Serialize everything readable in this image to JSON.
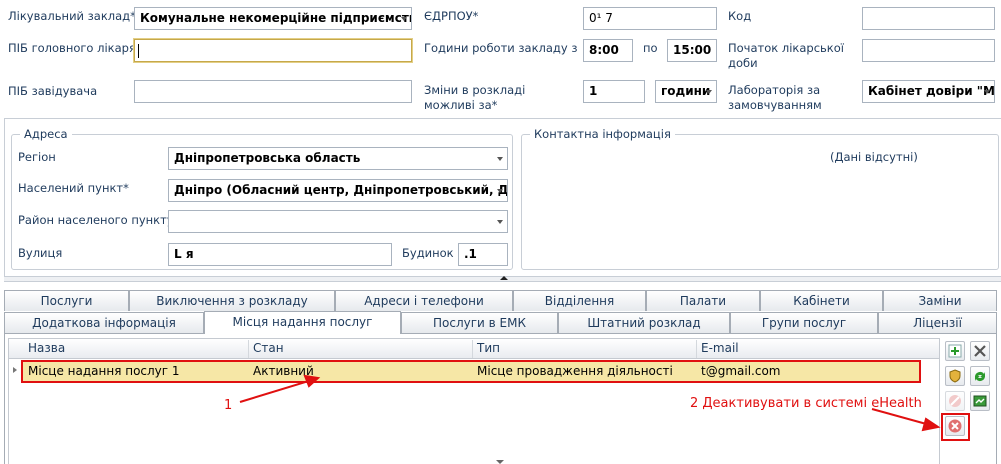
{
  "form": {
    "facility_label": "Лікувальний заклад*",
    "facility_value": "Комунальне некомерційне підприємство \"I",
    "edrpou_label": "ЄДРПОУ*",
    "edrpou_value": "0¹    7",
    "code_label": "Код",
    "code_value": "",
    "chief_label": "ПІБ головного лікаря",
    "chief_value": "",
    "hours_label": "Години роботи закладу з",
    "hours_from": "8:00",
    "hours_to_label": "по",
    "hours_to": "15:00",
    "start_label": "Початок лікарської доби",
    "start_value": "",
    "head_label": "ПІБ завідувача",
    "head_value": "",
    "changes_label": "Зміни в розкладі можливі за*",
    "changes_value": "1",
    "changes_unit": "години",
    "lab_label": "Лабораторія за замовчуванням",
    "lab_value": "Кабінет довіри \"Мі"
  },
  "address": {
    "title": "Адреса",
    "region_label": "Регіон",
    "region_value": "Дніпропетровська область",
    "city_label": "Населений пункт*",
    "city_value": "Дніпро (Обласний центр, Дніпропетровський, Дніпро",
    "district_label": "Район населеного пункту",
    "district_value": "",
    "street_label": "Вулиця",
    "street_value": "L     я",
    "house_label": "Будинок",
    "house_value": ".1"
  },
  "contact": {
    "title": "Контактна інформація",
    "empty_text": "(Дані відсутні)"
  },
  "tabs_row1": [
    "Послуги",
    "Виключення з розкладу",
    "Адреси і телефони",
    "Відділення",
    "Палати",
    "Кабінети",
    "Заміни"
  ],
  "tabs_row2": [
    "Додаткова інформація",
    "Місця надання послуг",
    "Послуги в ЕМК",
    "Штатний розклад",
    "Групи послуг",
    "Ліцензії"
  ],
  "active_tab": "Місця надання послуг",
  "grid": {
    "headers": [
      "Назва",
      "Стан",
      "Тип",
      "E-mail"
    ],
    "rows": [
      [
        "Місце надання послуг 1",
        "Активний",
        "Місце провадження діяльності",
        "     t@gmail.com"
      ]
    ]
  },
  "annotations": {
    "one": "1",
    "two": "2  Деактивувати в системі eHealth",
    "color": "#e01010"
  },
  "side_buttons": [
    "add-icon",
    "tools-icon",
    "shield-icon",
    "refresh-icon",
    "disabled-icon",
    "map-icon",
    "deactivate-icon"
  ]
}
